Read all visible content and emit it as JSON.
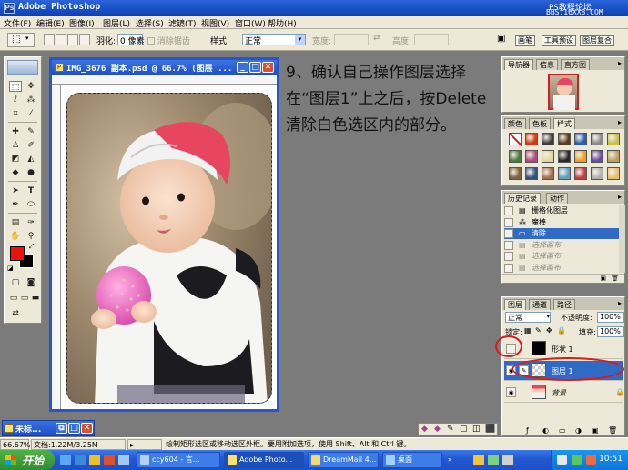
{
  "window": {
    "title": "Adobe Photoshop",
    "watermark_line1": "PS教程论坛",
    "watermark_line2": "BBS.16XX8.COM"
  },
  "menu": {
    "items": [
      "文件(F)",
      "编辑(E)",
      "图像(I)",
      "图层(L)",
      "选择(S)",
      "滤镜(T)",
      "视图(V)",
      "窗口(W)",
      "帮助(H)"
    ]
  },
  "options_bar": {
    "feather_label": "羽化:",
    "feather_value": "0 像素",
    "antialias_label": "消除锯齿",
    "style_label": "样式:",
    "style_value": "正常",
    "width_label": "宽度:",
    "height_label": "高度:",
    "well_tabs": [
      "画笔",
      "工具预设",
      "图层复合"
    ]
  },
  "document": {
    "title": "IMG_3676 副本.psd @ 66.7% (图层 ..."
  },
  "instruction": {
    "text": "9、确认自己操作图层选择在“图层1”上之后，按Delete清除白色选区内的部分。"
  },
  "navigator_panel": {
    "tabs": [
      "导航器",
      "信息",
      "直方图"
    ]
  },
  "styles_panel": {
    "tabs": [
      "颜色",
      "色板",
      "样式"
    ],
    "swatch_colors": [
      "#ffffff",
      "#d13a1a",
      "#3b3b3b",
      "#5a3a1e",
      "#2a5fb0",
      "#8a8a8a",
      "#c8c050",
      "#4a7a3a",
      "#b04a7a",
      "#e0d6a0",
      "#2a2a2a",
      "#f0a020",
      "#6a4a9a",
      "#c0a060",
      "#806040",
      "#305080",
      "#a07050",
      "#60a0c0",
      "#c04040",
      "#b0b0b0",
      "#e8c070"
    ]
  },
  "history_panel": {
    "tabs": [
      "历史记录",
      "动作"
    ],
    "items": [
      {
        "label": "栅格化图层",
        "state": "normal",
        "icon": "rasterize-icon"
      },
      {
        "label": "魔棒",
        "state": "normal",
        "icon": "magic-wand-icon"
      },
      {
        "label": "清除",
        "state": "active",
        "icon": "clear-icon"
      },
      {
        "label": "选择画布",
        "state": "dim",
        "icon": "select-icon"
      },
      {
        "label": "选择画布",
        "state": "dim",
        "icon": "select-icon"
      },
      {
        "label": "选择画布",
        "state": "dim",
        "icon": "select-icon"
      }
    ]
  },
  "layers_panel": {
    "tabs": [
      "图层",
      "通道",
      "路径"
    ],
    "blend_mode": "正常",
    "opacity_label": "不透明度:",
    "opacity_value": "100%",
    "lock_label": "锁定:",
    "fill_label": "填充:",
    "fill_value": "100%",
    "layers": [
      {
        "name": "形状 1",
        "active": false
      },
      {
        "name": "图层 1",
        "active": true
      },
      {
        "name": "背景",
        "active": false
      }
    ]
  },
  "minimized_window": {
    "title": "未标..."
  },
  "status_bar": {
    "zoom": "66.67%",
    "doc_size": "文档:1.22M/3.25M",
    "hint": "绘制矩形选区或移动选区外框。要用附加选项，使用 Shift、Alt 和 Ctrl 键。"
  },
  "taskbar": {
    "start_label": "开始",
    "tasks": [
      "ccy604 - 言...",
      "Adobe Photo...",
      "DreamMail 4...",
      "桌面"
    ],
    "clock": "10:51"
  },
  "colors": {
    "foreground": "#e8140c",
    "background": "#000000",
    "title_blue": "#2456c6",
    "highlight": "#316ac5",
    "annotation_red": "#e01818"
  }
}
